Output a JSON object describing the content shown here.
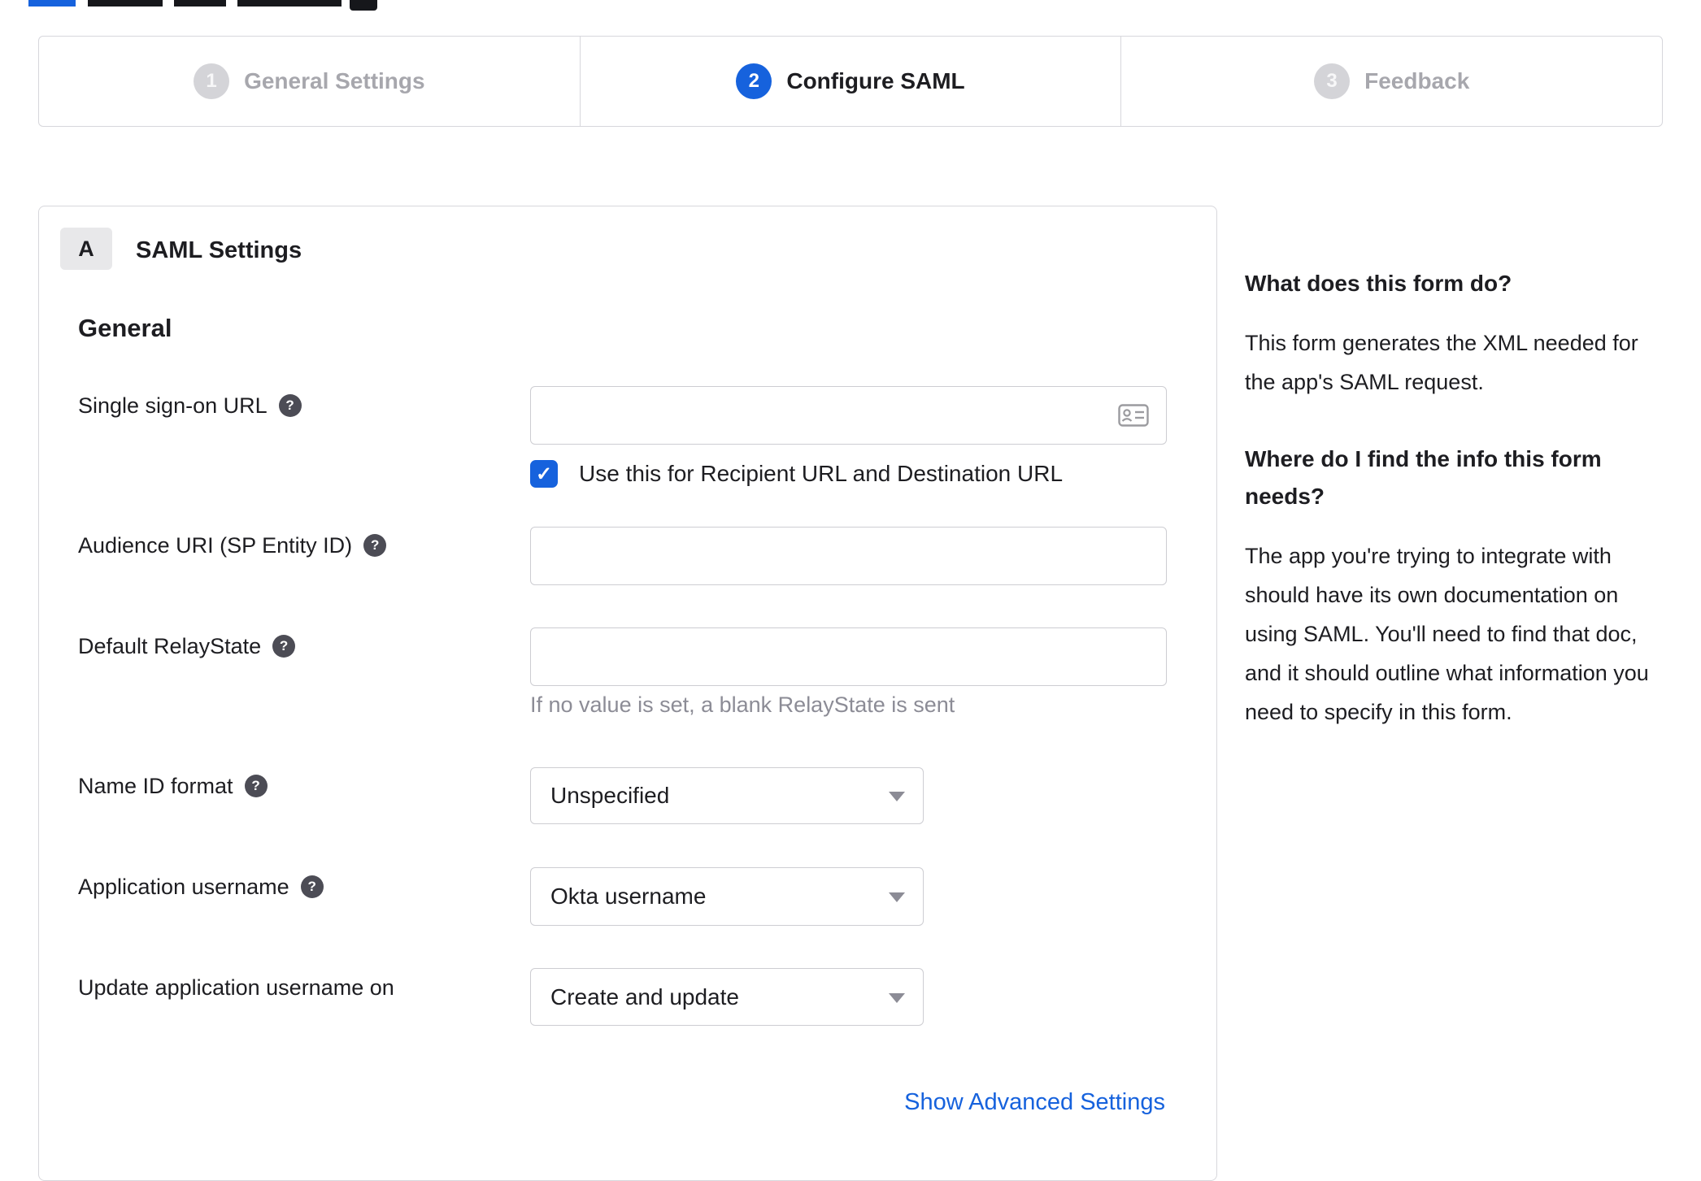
{
  "icons": {
    "help": "?",
    "check": "✓"
  },
  "stepper": {
    "steps": [
      {
        "number": "1",
        "label": "General Settings",
        "state": "inactive"
      },
      {
        "number": "2",
        "label": "Configure SAML",
        "state": "active"
      },
      {
        "number": "3",
        "label": "Feedback",
        "state": "inactive"
      }
    ]
  },
  "panel": {
    "section_badge": "A",
    "section_title": "SAML Settings",
    "group_title": "General",
    "fields": {
      "sso_url": {
        "label": "Single sign-on URL",
        "value": ""
      },
      "sso_checkbox": {
        "label": "Use this for Recipient URL and Destination URL",
        "checked": true
      },
      "audience_uri": {
        "label": "Audience URI (SP Entity ID)",
        "value": ""
      },
      "default_relaystate": {
        "label": "Default RelayState",
        "value": "",
        "hint": "If no value is set, a blank RelayState is sent"
      },
      "name_id_format": {
        "label": "Name ID format",
        "value": "Unspecified"
      },
      "application_username": {
        "label": "Application username",
        "value": "Okta username"
      },
      "update_app_username": {
        "label": "Update application username on",
        "value": "Create and update"
      }
    },
    "advanced_link": "Show Advanced Settings"
  },
  "sidebar": {
    "sections": [
      {
        "title": "What does this form do?",
        "body": "This form generates the XML needed for the app's SAML request."
      },
      {
        "title": "Where do I find the info this form needs?",
        "body": "The app you're trying to integrate with should have its own documentation on using SAML. You'll need to find that doc, and it should outline what information you need to specify in this form."
      }
    ]
  },
  "colors": {
    "accent_blue": "#1662dd",
    "border_gray": "#d7d7dc",
    "inactive_gray": "#a7a7ad",
    "text_dark": "#1d1d21",
    "hint_gray": "#8c8c96"
  }
}
